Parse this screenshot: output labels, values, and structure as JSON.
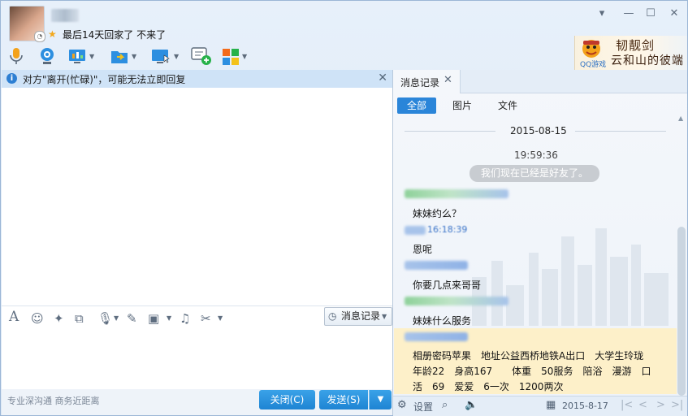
{
  "header": {
    "signature": "最后14天回家了 不来了"
  },
  "window_controls": {
    "menu": "▾",
    "minimize": "—",
    "maximize": "☐",
    "close": "✕"
  },
  "toolbar": {
    "icons": [
      "voice-call-icon",
      "video-call-icon",
      "screen-share-icon",
      "file-transfer-icon",
      "remote-desktop-icon",
      "add-app-icon",
      "apps-grid-icon"
    ]
  },
  "ad": {
    "line1": "韧靓剑",
    "line2": "云和山的彼端",
    "brand": "QQ游戏"
  },
  "notice": {
    "text": "对方\"离开(忙碌)\"，可能无法立即回复"
  },
  "format_toolbar": {
    "history_label": "消息记录"
  },
  "bottom": {
    "slogan": "专业深沟通 商务近距离",
    "close_label": "关闭(C)",
    "send_label": "发送(S)"
  },
  "history": {
    "tab_label": "消息记录",
    "filters": [
      "全部",
      "图片",
      "文件"
    ],
    "active_filter": "全部",
    "date_separator": "2015-08-15",
    "system_time": "19:59:36",
    "system_message": "我们现在已经是好友了。",
    "messages": [
      {
        "text": "妹妹约么？"
      },
      {
        "sender_time_partial": "16:18:39"
      },
      {
        "text": "恩呢"
      },
      {
        "text": "你要几点来哥哥"
      },
      {
        "text": "妹妹什么服务"
      },
      {
        "text": "相册密码苹果　地址公益西桥地铁A出口　大学生玲珑　年龄22　身高167　　体重　50服务　陪浴　漫游　口活　69　爱爱　6一次　1200两次"
      }
    ],
    "bottom_bar": {
      "settings_label": "设置",
      "date": "2015-8-17"
    }
  },
  "colors": {
    "accent": "#2a85d9",
    "highlight": "#fdf0c9",
    "notice_bg": "#cfe3f7"
  }
}
